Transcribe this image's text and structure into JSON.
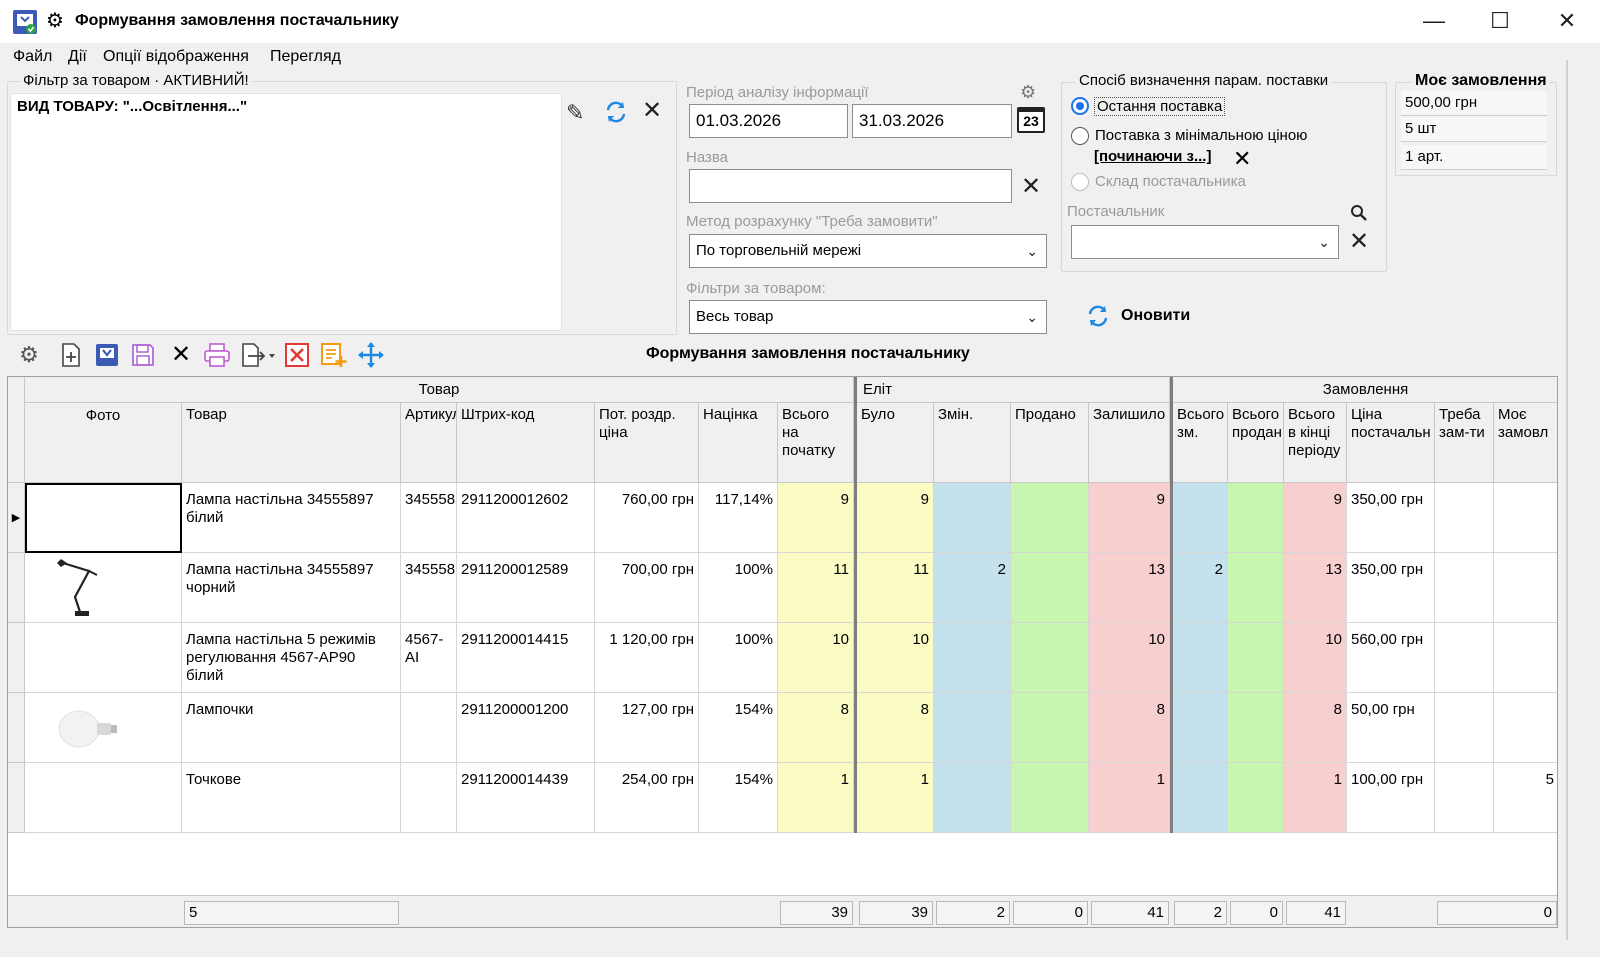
{
  "window": {
    "title": "Формування замовлення постачальнику"
  },
  "menu": [
    "Файл",
    "Дії",
    "Опції відображення",
    "Перегляд"
  ],
  "filter_panel": {
    "group_title": "Фільтр за товаром · АКТИВНИЙ!",
    "text": "ВИД ТОВАРУ: \"...Освітлення...\""
  },
  "period": {
    "label": "Період аналізу інформації",
    "date_from": "01.03.2026",
    "date_to": "31.03.2026",
    "calendar_day": "23"
  },
  "name_field": {
    "label": "Назва",
    "value": ""
  },
  "calc_method": {
    "label": "Метод розрахунку \"Треба замовити\"",
    "value": "По торговельній мережі"
  },
  "product_filters": {
    "label": "Фільтри за товаром:",
    "value": "Весь товар"
  },
  "supply": {
    "group_title": "Спосіб визначення парам. поставки",
    "options": [
      "Остання поставка",
      "Поставка з мінімальною ціною",
      "Склад постачальника"
    ],
    "selected": "Остання поставка",
    "starting_link": "[починаючи з...]",
    "supplier_label": "Постачальник",
    "supplier_value": ""
  },
  "my_order": {
    "title": "Моє замовлення",
    "sum": "500,00 грн",
    "qty": "5 шт",
    "articles": "1 арт."
  },
  "refresh_button": "Оновити",
  "toolbar_title": "Формування замовлення постачальнику",
  "toolbar_icons": [
    "gear-icon",
    "new-document-icon",
    "import-icon",
    "save-icon",
    "delete-icon",
    "print-icon",
    "export-icon",
    "clear-red-icon",
    "add-orange-icon",
    "move-icon"
  ],
  "grid": {
    "groups": [
      "Товар",
      "Еліт",
      "Замовлення"
    ],
    "columns": [
      "Фото",
      "Товар",
      "Артикул",
      "Штрих-код",
      "Пот. роздр. ціна",
      "Націнка",
      "Всього на початку",
      "Було",
      "Змін.",
      "Продано",
      "Залишило",
      "Всього зм.",
      "Всього продан",
      "Всього в кінці періоду",
      "Ціна постачальн",
      "Треба зам-ти",
      "Моє замовл"
    ],
    "rows": [
      {
        "name": "Лампа настільна 34555897 білий",
        "article": "345558",
        "barcode": "2911200012602",
        "price": "760,00 грн",
        "markup": "117,14%",
        "start": "9",
        "was": "9",
        "chg": "",
        "sold": "",
        "left": "9",
        "tot_chg": "",
        "tot_sold": "",
        "tot_end": "9",
        "supp_price": "350,00 грн",
        "need": "",
        "mine": ""
      },
      {
        "name": "Лампа настільна 34555897 чорний",
        "article": "345558",
        "barcode": "2911200012589",
        "price": "700,00 грн",
        "markup": "100%",
        "start": "11",
        "was": "11",
        "chg": "2",
        "sold": "",
        "left": "13",
        "tot_chg": "2",
        "tot_sold": "",
        "tot_end": "13",
        "supp_price": "350,00 грн",
        "need": "",
        "mine": ""
      },
      {
        "name": "Лампа настільна 5 режимів регулювання 4567-AP90 білий",
        "article": "4567-AI",
        "barcode": "2911200014415",
        "price": "1 120,00 грн",
        "markup": "100%",
        "start": "10",
        "was": "10",
        "chg": "",
        "sold": "",
        "left": "10",
        "tot_chg": "",
        "tot_sold": "",
        "tot_end": "10",
        "supp_price": "560,00 грн",
        "need": "",
        "mine": ""
      },
      {
        "name": "Лампочки",
        "article": "",
        "barcode": "2911200001200",
        "price": "127,00 грн",
        "markup": "154%",
        "start": "8",
        "was": "8",
        "chg": "",
        "sold": "",
        "left": "8",
        "tot_chg": "",
        "tot_sold": "",
        "tot_end": "8",
        "supp_price": "50,00 грн",
        "need": "",
        "mine": ""
      },
      {
        "name": "Точкове",
        "article": "",
        "barcode": "2911200014439",
        "price": "254,00 грн",
        "markup": "154%",
        "start": "1",
        "was": "1",
        "chg": "",
        "sold": "",
        "left": "1",
        "tot_chg": "",
        "tot_sold": "",
        "tot_end": "1",
        "supp_price": "100,00 грн",
        "need": "",
        "mine": "5"
      }
    ],
    "footer": {
      "count": "5",
      "start": "39",
      "was": "39",
      "chg": "2",
      "sold": "0",
      "left": "41",
      "tot_chg": "2",
      "tot_sold": "0",
      "tot_end": "41",
      "need": "0"
    }
  }
}
